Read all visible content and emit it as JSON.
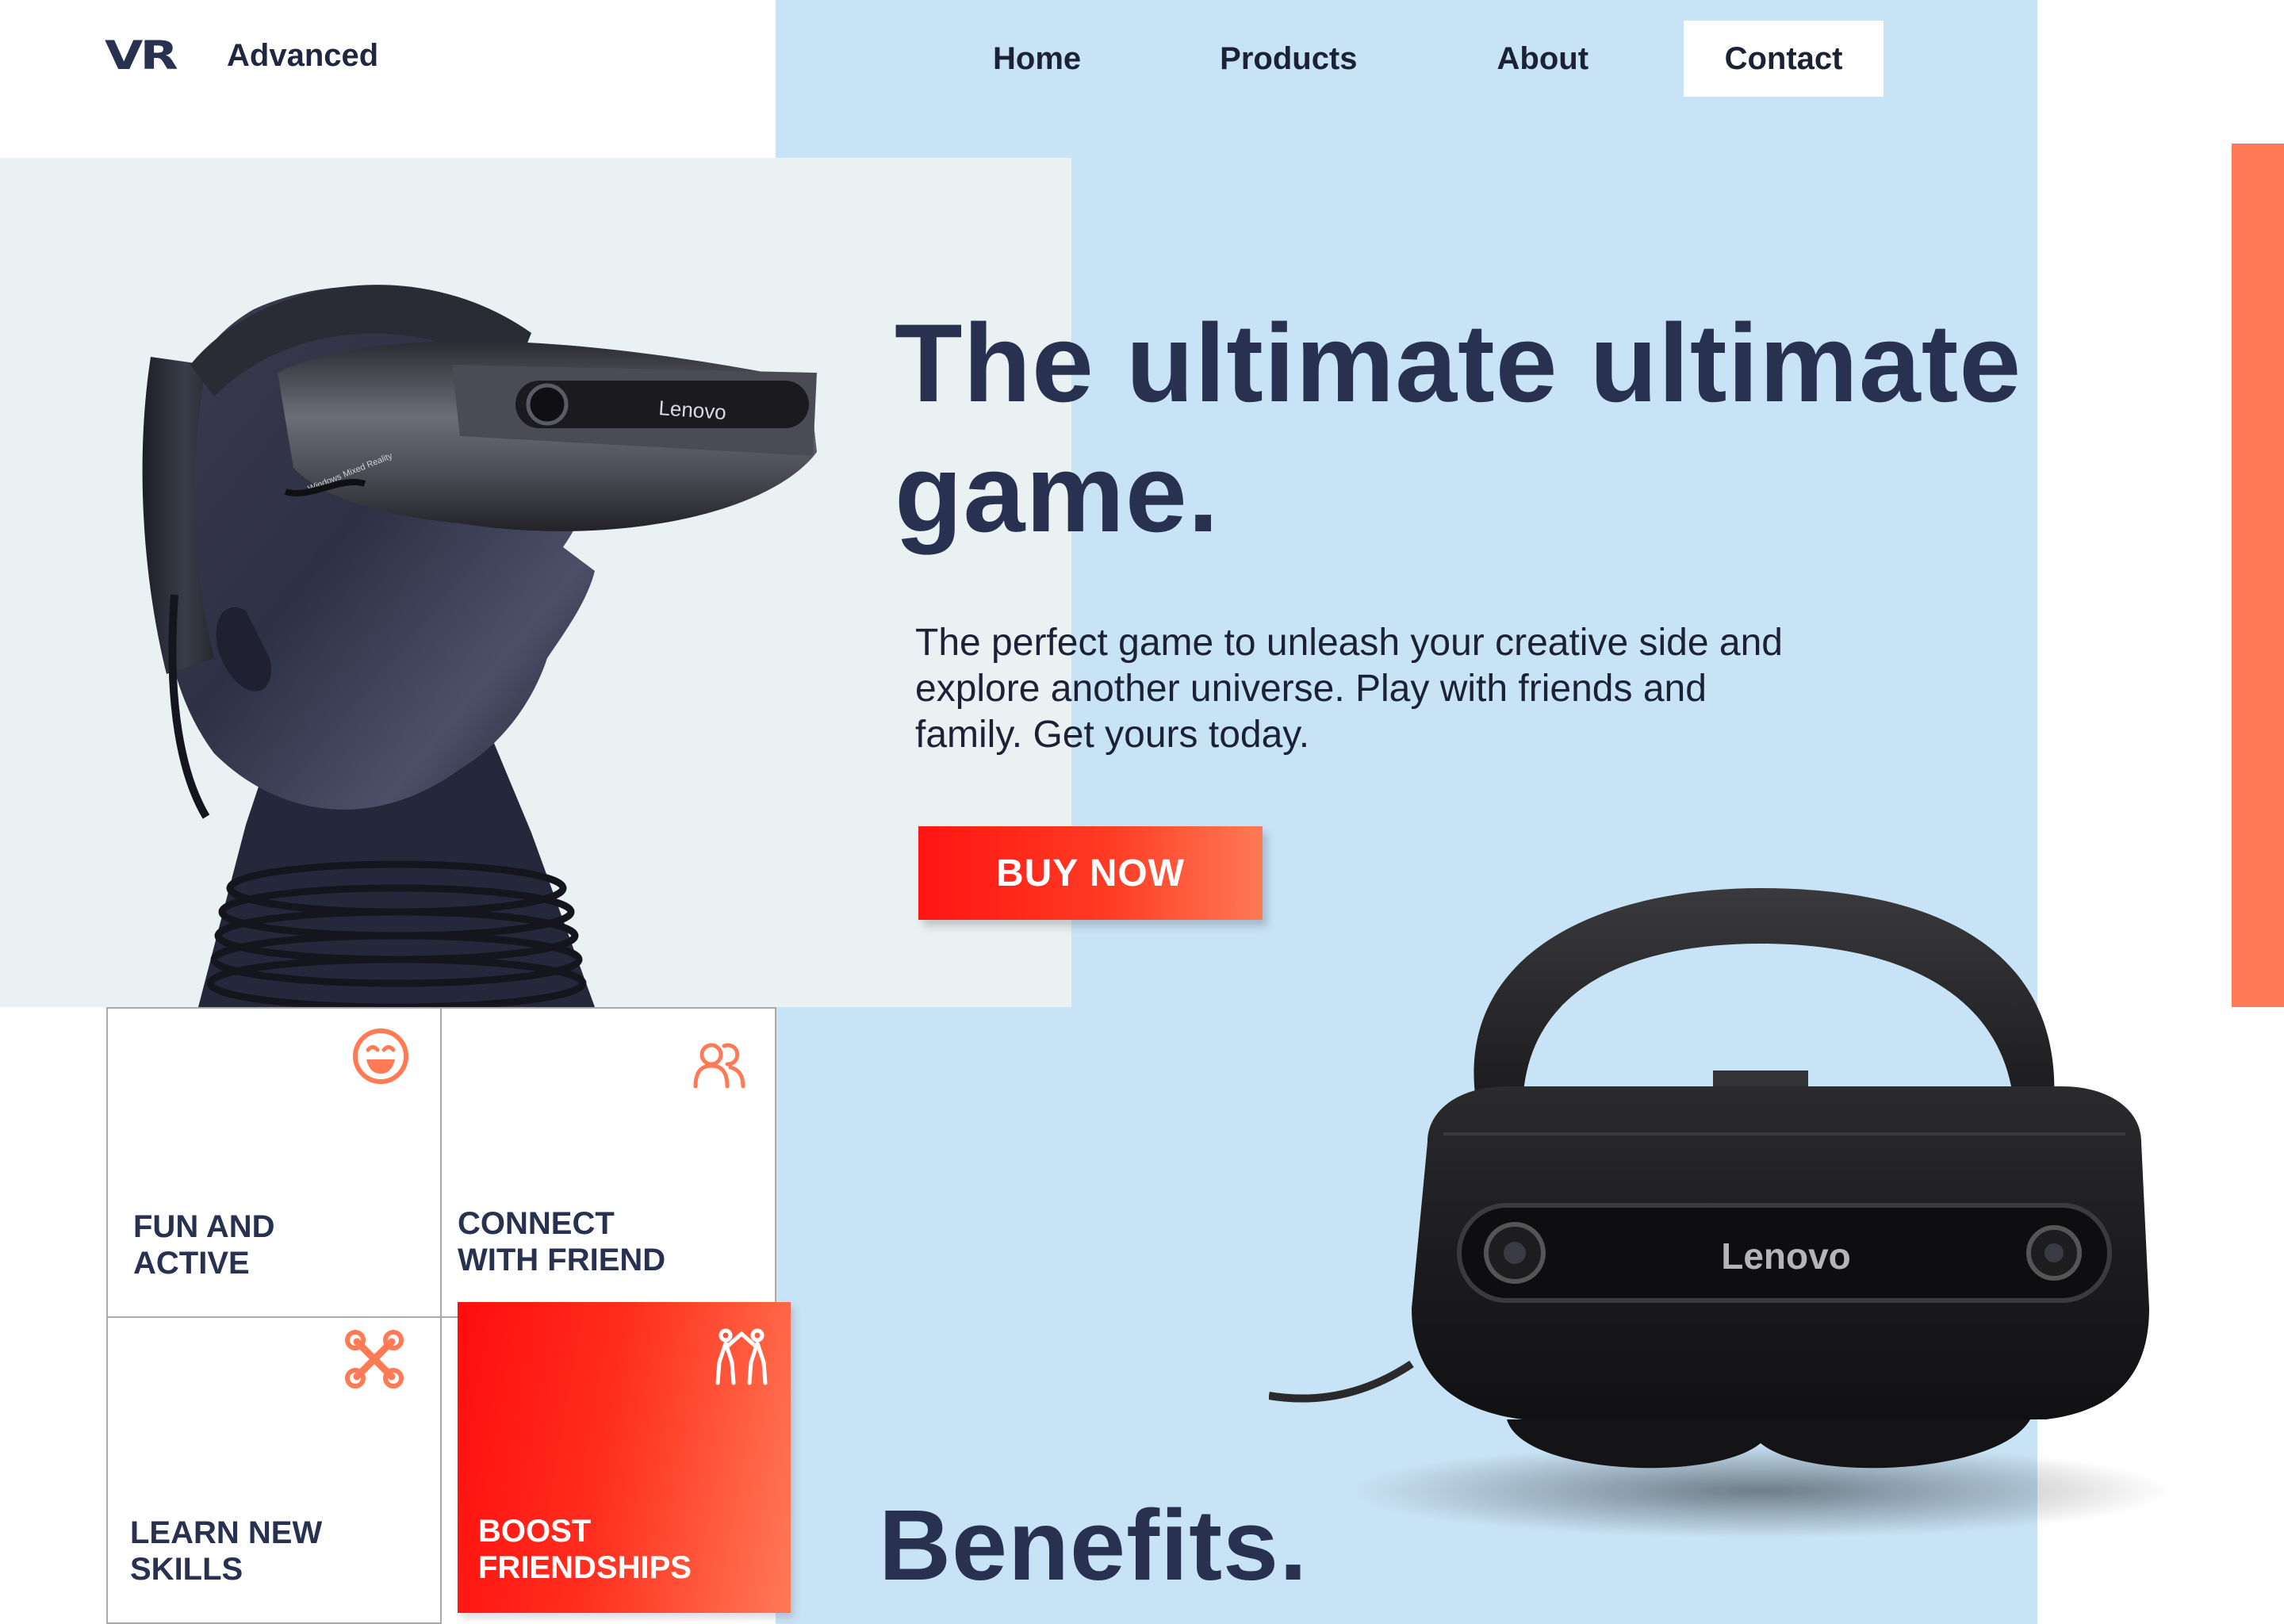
{
  "brand": {
    "mark": "VR",
    "name": "Advanced"
  },
  "nav": {
    "items": [
      {
        "label": "Home"
      },
      {
        "label": "Products"
      },
      {
        "label": "About"
      },
      {
        "label": "Contact",
        "active": true
      }
    ]
  },
  "hero": {
    "title": "The ultimate ultimate game.",
    "description": "The perfect game to unleash your creative side and explore another universe. Play with friends and family. Get yours today.",
    "cta_label": "BUY NOW",
    "headset_brand": "Lenovo",
    "headset_subtext": "Windows Mixed Reality"
  },
  "product": {
    "brand": "Lenovo"
  },
  "benefits": {
    "title": "Benefits.",
    "cards": [
      {
        "label": "FUN AND\nACTIVE",
        "icon": "smiley-icon"
      },
      {
        "label": "CONNECT\nWITH FRIEND",
        "icon": "users-icon"
      },
      {
        "label": "LEARN NEW\nSKILLS",
        "icon": "tools-icon"
      },
      {
        "label": "BOOST\nFRIENDSHIPS",
        "icon": "friends-icon"
      }
    ]
  },
  "colors": {
    "navy": "#283250",
    "light_blue": "#c9e3f6",
    "hero_light": "#eaf1f3",
    "accent_orange": "#ff7a55",
    "accent_red": "#ff1512"
  }
}
